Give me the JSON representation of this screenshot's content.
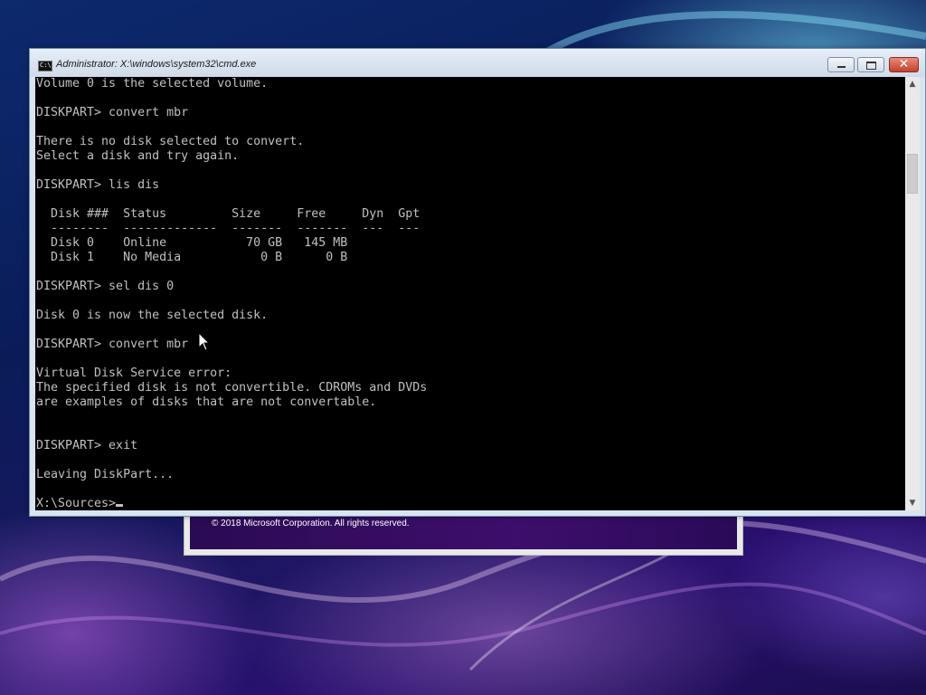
{
  "setup": {
    "copyright": "© 2018 Microsoft Corporation. All rights reserved."
  },
  "window": {
    "title": "Administrator: X:\\windows\\system32\\cmd.exe",
    "icon_label": "C:\\",
    "icon": "console-icon"
  },
  "buttons": {
    "minimize_icon": "minimize-icon",
    "maximize_icon": "maximize-icon",
    "close_glyph": "✕"
  },
  "scrollbar": {
    "up_glyph": "▲",
    "down_glyph": "▼"
  },
  "console": {
    "lines": [
      "Volume 0 is the selected volume.",
      "",
      "DISKPART> convert mbr",
      "",
      "There is no disk selected to convert.",
      "Select a disk and try again.",
      "",
      "DISKPART> lis dis",
      "",
      "  Disk ###  Status         Size     Free     Dyn  Gpt",
      "  --------  -------------  -------  -------  ---  ---",
      "  Disk 0    Online           70 GB   145 MB",
      "  Disk 1    No Media           0 B      0 B",
      "",
      "DISKPART> sel dis 0",
      "",
      "Disk 0 is now the selected disk.",
      "",
      "DISKPART> convert mbr",
      "",
      "Virtual Disk Service error:",
      "The specified disk is not convertible. CDROMs and DVDs",
      "are examples of disks that are not convertable.",
      "",
      "",
      "DISKPART> exit",
      "",
      "Leaving DiskPart...",
      "",
      "X:\\Sources>"
    ]
  },
  "colors": {
    "console_bg": "#000000",
    "console_fg": "#c0c0c0",
    "close_button": "#c4402c"
  }
}
